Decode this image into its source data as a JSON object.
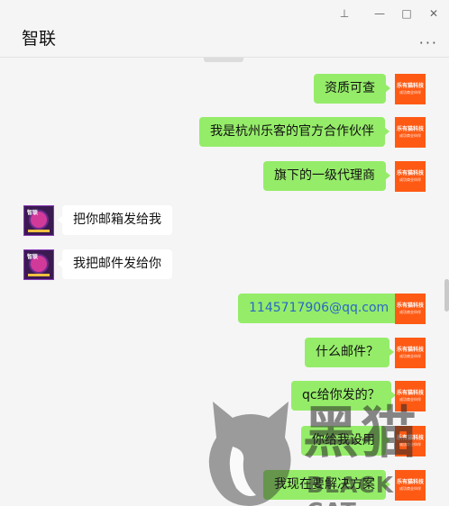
{
  "window": {
    "title": "智联",
    "controls": {
      "pin": "⊥",
      "minimize": "—",
      "maximize": "□",
      "close": "✕"
    },
    "more_label": "···"
  },
  "avatars": {
    "me": {
      "line1": "乐有猫科技",
      "line2": "成功商业伙伴"
    },
    "other": {
      "text": "智联"
    }
  },
  "messages": [
    {
      "side": "me",
      "text": "资质可查"
    },
    {
      "side": "me",
      "text": "我是杭州乐客的官方合作伙伴"
    },
    {
      "side": "me",
      "text": "旗下的一级代理商"
    },
    {
      "side": "other",
      "text": "把你邮箱发给我"
    },
    {
      "side": "other",
      "text": "我把邮件发给你"
    },
    {
      "side": "me",
      "text": "1145717906@qq.com",
      "link": true
    },
    {
      "side": "me",
      "text": "什么邮件？"
    },
    {
      "side": "me",
      "text": "qc给你发的？"
    },
    {
      "side": "me",
      "text": "你给我设用"
    },
    {
      "side": "me",
      "text": "我现在要解决方案"
    }
  ],
  "watermark": {
    "cn": "黑猫",
    "en": "BLACK CAT"
  },
  "colors": {
    "bubble_me": "#95ec69",
    "bubble_other": "#ffffff",
    "avatar_me": "#ff5a14",
    "link": "#2a67c5",
    "background": "#f5f5f5"
  }
}
